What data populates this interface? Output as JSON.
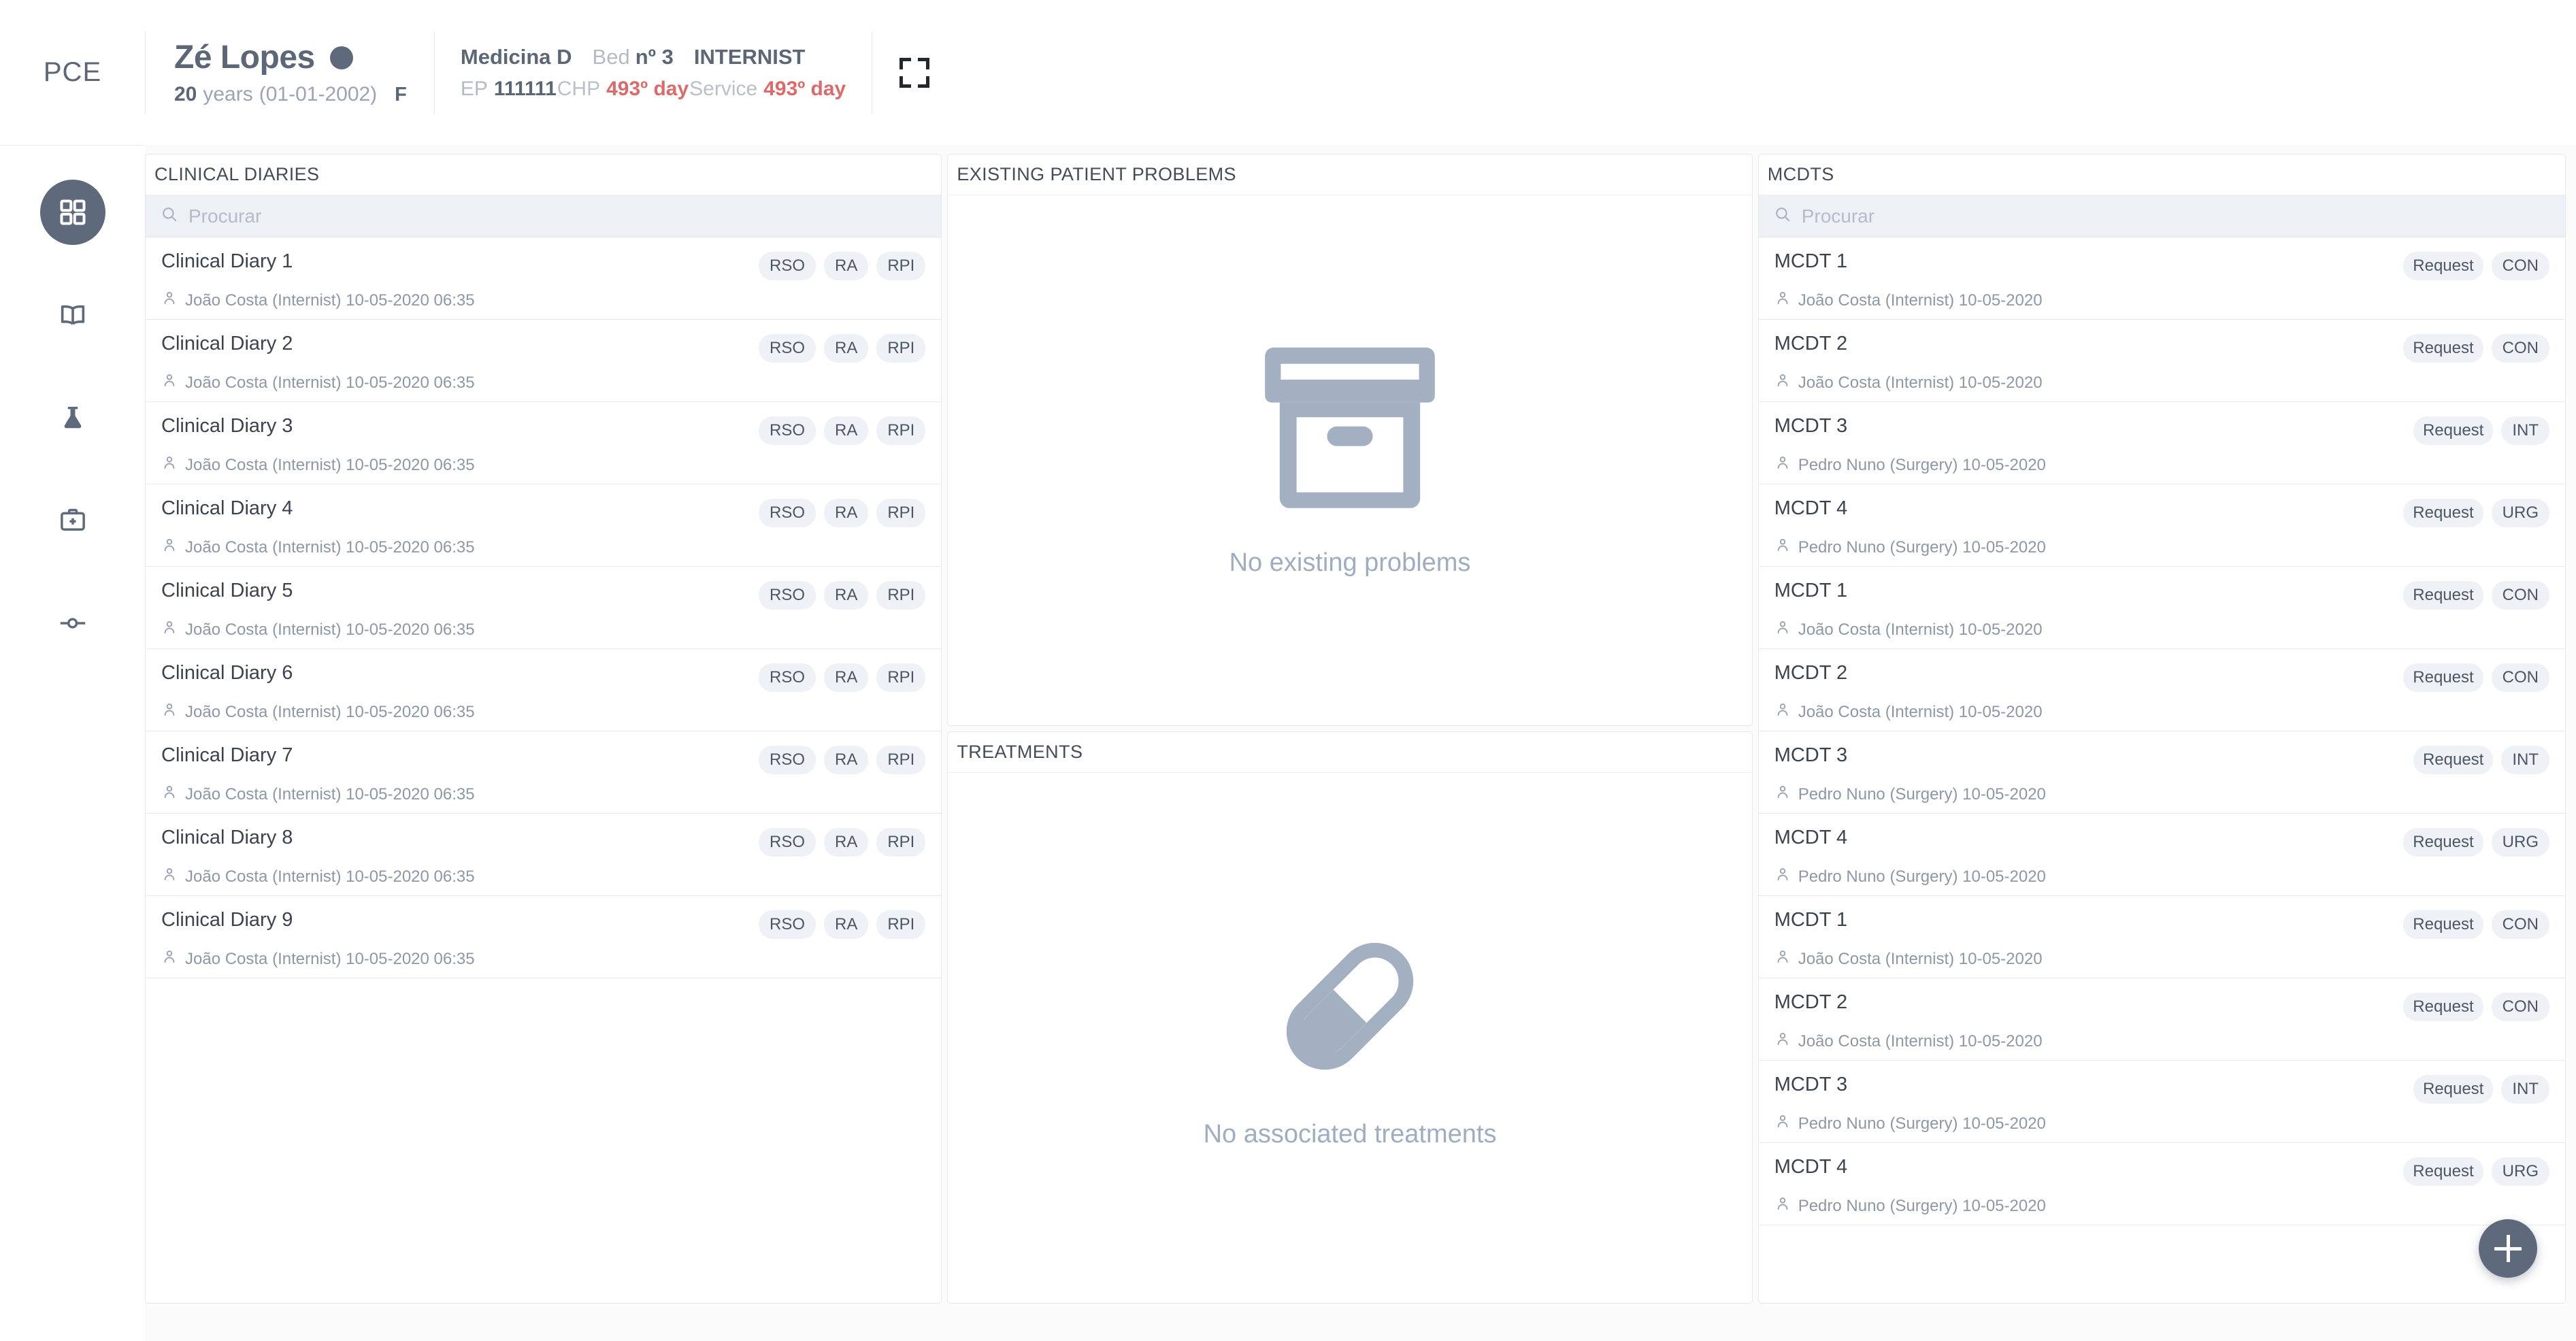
{
  "app": {
    "logo": "PCE"
  },
  "patient": {
    "name": "Zé Lopes",
    "age_number": "20",
    "age_unit": "years",
    "dob": "(01-01-2002)",
    "sex": "F"
  },
  "admission": {
    "unit": "Medicina D",
    "bed_label": "Bed",
    "bed_number": "nº 3",
    "specialty": "INTERNIST",
    "ep_label": "EP",
    "ep_number": "111111",
    "chp_label": "CHP",
    "chp_days": "493º day",
    "service_label": "Service",
    "service_days": "493º day"
  },
  "sidebar": {
    "items": [
      {
        "name": "dashboard",
        "icon": "grid-icon",
        "active": true
      },
      {
        "name": "notes",
        "icon": "book-icon",
        "active": false
      },
      {
        "name": "labs",
        "icon": "flask-icon",
        "active": false
      },
      {
        "name": "medical-kit",
        "icon": "medical-bag-icon",
        "active": false
      },
      {
        "name": "timeline",
        "icon": "timeline-node-icon",
        "active": false
      }
    ]
  },
  "search": {
    "placeholder": "Procurar",
    "value": ""
  },
  "panels": {
    "clinical_diaries": {
      "title": "CLINICAL DIARIES",
      "rows": [
        {
          "title": "Clinical Diary 1",
          "author": "João Costa (Internist) 10-05-2020 06:35",
          "tags": [
            "RSO",
            "RA",
            "RPI"
          ]
        },
        {
          "title": "Clinical Diary 2",
          "author": "João Costa (Internist) 10-05-2020 06:35",
          "tags": [
            "RSO",
            "RA",
            "RPI"
          ]
        },
        {
          "title": "Clinical Diary 3",
          "author": "João Costa (Internist) 10-05-2020 06:35",
          "tags": [
            "RSO",
            "RA",
            "RPI"
          ]
        },
        {
          "title": "Clinical Diary 4",
          "author": "João Costa (Internist) 10-05-2020 06:35",
          "tags": [
            "RSO",
            "RA",
            "RPI"
          ]
        },
        {
          "title": "Clinical Diary 5",
          "author": "João Costa (Internist) 10-05-2020 06:35",
          "tags": [
            "RSO",
            "RA",
            "RPI"
          ]
        },
        {
          "title": "Clinical Diary 6",
          "author": "João Costa (Internist) 10-05-2020 06:35",
          "tags": [
            "RSO",
            "RA",
            "RPI"
          ]
        },
        {
          "title": "Clinical Diary 7",
          "author": "João Costa (Internist) 10-05-2020 06:35",
          "tags": [
            "RSO",
            "RA",
            "RPI"
          ]
        },
        {
          "title": "Clinical Diary 8",
          "author": "João Costa (Internist) 10-05-2020 06:35",
          "tags": [
            "RSO",
            "RA",
            "RPI"
          ]
        },
        {
          "title": "Clinical Diary 9",
          "author": "João Costa (Internist) 10-05-2020 06:35",
          "tags": [
            "RSO",
            "RA",
            "RPI"
          ]
        }
      ]
    },
    "existing_problems": {
      "title": "EXISTING PATIENT PROBLEMS",
      "empty_text": "No existing problems",
      "empty_icon": "archive-box-icon"
    },
    "treatments": {
      "title": "TREATMENTS",
      "empty_text": "No associated treatments",
      "empty_icon": "pill-capsule-icon"
    },
    "mcdts": {
      "title": "MCDTS",
      "rows": [
        {
          "title": "MCDT 1",
          "author": "João Costa (Internist) 10-05-2020",
          "tags": [
            "Request",
            "CON"
          ]
        },
        {
          "title": "MCDT 2",
          "author": "João Costa (Internist) 10-05-2020",
          "tags": [
            "Request",
            "CON"
          ]
        },
        {
          "title": "MCDT 3",
          "author": "Pedro Nuno (Surgery) 10-05-2020",
          "tags": [
            "Request",
            "INT"
          ]
        },
        {
          "title": "MCDT 4",
          "author": "Pedro Nuno (Surgery) 10-05-2020",
          "tags": [
            "Request",
            "URG"
          ]
        },
        {
          "title": "MCDT 1",
          "author": "João Costa (Internist) 10-05-2020",
          "tags": [
            "Request",
            "CON"
          ]
        },
        {
          "title": "MCDT 2",
          "author": "João Costa (Internist) 10-05-2020",
          "tags": [
            "Request",
            "CON"
          ]
        },
        {
          "title": "MCDT 3",
          "author": "Pedro Nuno (Surgery) 10-05-2020",
          "tags": [
            "Request",
            "INT"
          ]
        },
        {
          "title": "MCDT 4",
          "author": "Pedro Nuno (Surgery) 10-05-2020",
          "tags": [
            "Request",
            "URG"
          ]
        },
        {
          "title": "MCDT 1",
          "author": "João Costa (Internist) 10-05-2020",
          "tags": [
            "Request",
            "CON"
          ]
        },
        {
          "title": "MCDT 2",
          "author": "João Costa (Internist) 10-05-2020",
          "tags": [
            "Request",
            "CON"
          ]
        },
        {
          "title": "MCDT 3",
          "author": "Pedro Nuno (Surgery) 10-05-2020",
          "tags": [
            "Request",
            "INT"
          ]
        },
        {
          "title": "MCDT 4",
          "author": "Pedro Nuno (Surgery) 10-05-2020",
          "tags": [
            "Request",
            "URG"
          ]
        }
      ]
    }
  },
  "fab": {
    "icon": "plus-icon",
    "label": "+"
  },
  "colors": {
    "accent": "#5e6a7b",
    "alert": "#dc6a6a",
    "text_dark": "#3b434f",
    "text_muted": "#8d98a6",
    "tag_bg": "#eef2f7",
    "empty_icon": "#a3b0c2",
    "search_bg": "#edf0f4",
    "panel_border": "#e6e8eb",
    "page_bg": "#fbfbfc"
  }
}
